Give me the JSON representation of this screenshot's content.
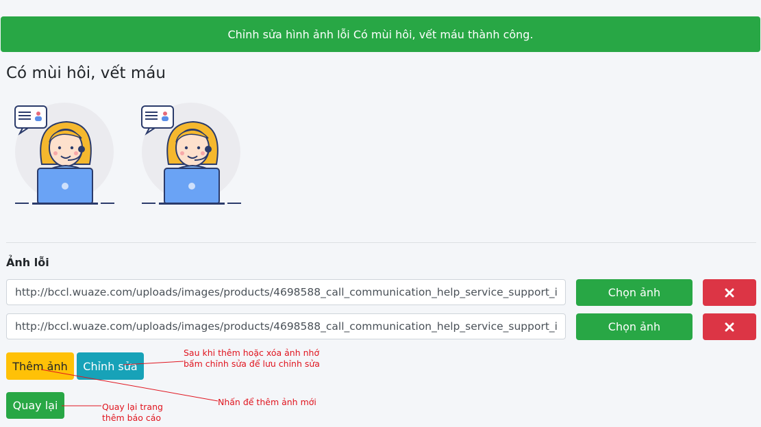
{
  "alert": {
    "message": "Chỉnh sửa hình ảnh lỗi Có mùi hôi, vết máu thành công."
  },
  "page": {
    "title": "Có mùi hôi, vết máu"
  },
  "images": {
    "alt": "call_communication_help_service_support_icon",
    "count": 2
  },
  "form": {
    "section_label": "Ảnh lỗi",
    "rows": [
      {
        "url": "http://bccl.wuaze.com/uploads/images/products/4698588_call_communication_help_service_support_icon.png",
        "choose_label": "Chọn ảnh",
        "remove_icon": "close-icon"
      },
      {
        "url": "http://bccl.wuaze.com/uploads/images/products/4698588_call_communication_help_service_support_icon.png",
        "choose_label": "Chọn ảnh",
        "remove_icon": "close-icon"
      }
    ],
    "add_image_label": "Thêm ảnh",
    "edit_label": "Chỉnh sửa",
    "back_label": "Quay lại"
  },
  "annotations": {
    "edit_note_line1": "Sau khi thêm hoặc xóa ảnh nhớ",
    "edit_note_line2": "bấm chỉnh sửa để lưu chỉnh sửa",
    "add_note": "Nhấn để thêm ảnh mới",
    "back_note_line1": "Quay lại trang",
    "back_note_line2": "thêm báo cáo"
  },
  "colors": {
    "success": "#28a745",
    "danger": "#dc3545",
    "warning": "#ffc107",
    "info": "#17a2b8",
    "annotation": "#e0141e"
  }
}
